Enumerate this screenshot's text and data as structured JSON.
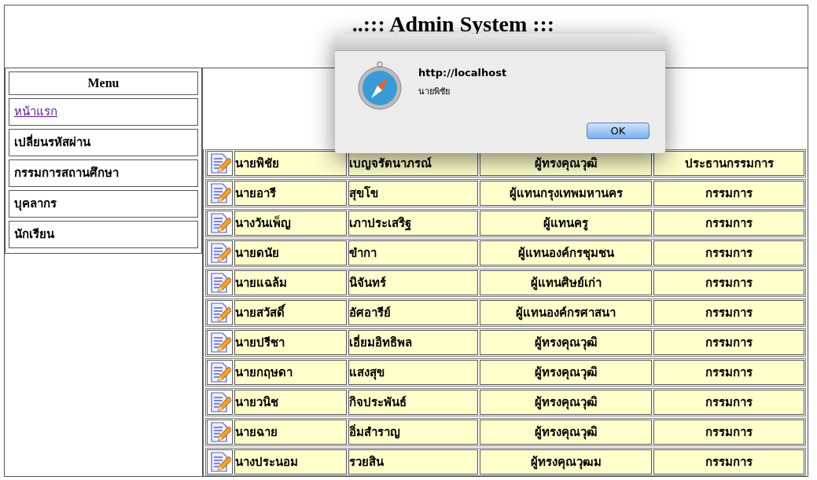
{
  "header": {
    "title": "..::: Admin System :::"
  },
  "menu": {
    "title": "Menu",
    "items": [
      {
        "label": "หน้าแรก",
        "kind": "link"
      },
      {
        "label": "เปลี่ยนรหัสผ่าน",
        "kind": "text"
      },
      {
        "label": "กรรมการสถานศึกษา",
        "kind": "text"
      },
      {
        "label": "บุคลากร",
        "kind": "text"
      },
      {
        "label": "นักเรียน",
        "kind": "text"
      }
    ]
  },
  "table": {
    "rows": [
      {
        "first_name": "นายพิชัย",
        "last_name": "เบญจรัตนาภรณ์",
        "representing": "ผู้ทรงคุณวุฒิ",
        "position": "ประธานกรรมการ"
      },
      {
        "first_name": "นายอารี",
        "last_name": "สุขโข",
        "representing": "ผู้แทนกรุงเทพมหานคร",
        "position": "กรรมการ"
      },
      {
        "first_name": "นางวันเพ็ญ",
        "last_name": "เภาประเสริฐ",
        "representing": "ผู้แทนครู",
        "position": "กรรมการ"
      },
      {
        "first_name": "นายดนัย",
        "last_name": "ขำกา",
        "representing": "ผู้แทนองค์กรชุมชน",
        "position": "กรรมการ"
      },
      {
        "first_name": "นายแฉล้ม",
        "last_name": "นิจันทร์",
        "representing": "ผู้แทนศิษย์เก่า",
        "position": "กรรมการ"
      },
      {
        "first_name": "นายสวัสดิ์",
        "last_name": "อัศอารีย์",
        "representing": "ผู้แทนองค์กรศาสนา",
        "position": "กรรมการ"
      },
      {
        "first_name": "นายปรีชา",
        "last_name": "เอี่ยมอิทธิพล",
        "representing": "ผู้ทรงคุณวุฒิ",
        "position": "กรรมการ"
      },
      {
        "first_name": "นายกฤษดา",
        "last_name": "แสงสุข",
        "representing": "ผู้ทรงคุณวุฒิ",
        "position": "กรรมการ"
      },
      {
        "first_name": "นายวนิช",
        "last_name": "กิจประพันธ์",
        "representing": "ผู้ทรงคุณวุฒิ",
        "position": "กรรมการ"
      },
      {
        "first_name": "นายฉาย",
        "last_name": "อิ่มสำราญ",
        "representing": "ผู้ทรงคุณวุฒิ",
        "position": "กรรมการ"
      },
      {
        "first_name": "นางประนอม",
        "last_name": "รวยสิน",
        "representing": "ผู้ทรงคุณวุฒม",
        "position": "กรรมการ"
      }
    ]
  },
  "dialog": {
    "title": "http://localhost",
    "message": "นายพิชัย",
    "button": "OK"
  }
}
